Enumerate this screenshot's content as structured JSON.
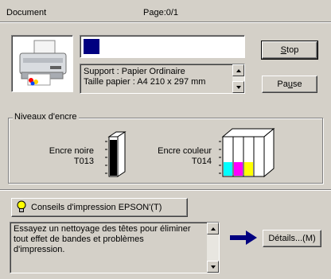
{
  "header": {
    "document_label": "Document",
    "page_label": "Page:0/1"
  },
  "progress": {
    "fraction": 0.06,
    "color": "#000080"
  },
  "status": {
    "line1": "Support : Papier Ordinaire",
    "line2": "Taille papier : A4 210 x 297 mm"
  },
  "buttons": {
    "stop_prefix": "",
    "stop_mnemonic": "S",
    "stop_suffix": "top",
    "pause_prefix": "Pa",
    "pause_mnemonic": "u",
    "pause_suffix": "se",
    "tips": "Conseils d'impression EPSON'(T)",
    "details": "Détails...(M)"
  },
  "ink": {
    "group_title": "Niveaux d'encre",
    "black_label": "Encre noire",
    "black_code": "T013",
    "color_label": "Encre couleur",
    "color_code": "T014",
    "colors": {
      "cyan": "#00ffff",
      "magenta": "#ff00ff",
      "yellow": "#ffff00",
      "black": "#000000"
    }
  },
  "tips_text": {
    "line1": "Essayez un nettoyage des têtes pour éliminer",
    "line2": "tout effet de bandes et problèmes",
    "line3": "d'impression."
  },
  "icons": [
    "printer-icon",
    "lightbulb-icon",
    "arrow-right-icon"
  ]
}
